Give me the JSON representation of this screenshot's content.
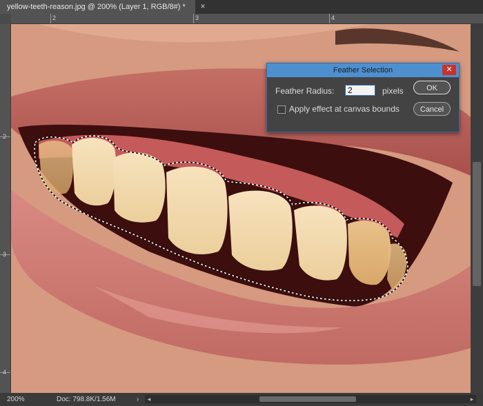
{
  "document": {
    "tab_title": "yellow-teeth-reason.jpg @ 200% (Layer 1, RGB/8#) *",
    "close_glyph": "×"
  },
  "rulers": {
    "top_labels": [
      "2",
      "3",
      "4"
    ],
    "left_labels": [
      "2",
      "3",
      "4"
    ]
  },
  "status": {
    "zoom": "200%",
    "doc_size": "Doc: 798.8K/1.56M",
    "arrow": "›"
  },
  "dialog": {
    "title": "Feather Selection",
    "feather_radius_label": "Feather Radius:",
    "feather_radius_value": "2",
    "unit": "pixels",
    "canvas_bounds_label": "Apply effect at canvas bounds",
    "canvas_bounds_checked": false,
    "ok_label": "OK",
    "cancel_label": "Cancel"
  },
  "colors": {
    "title_bar": "#4e8fd0",
    "close_button": "#c8322c",
    "selection_outline": "#ffffff"
  }
}
